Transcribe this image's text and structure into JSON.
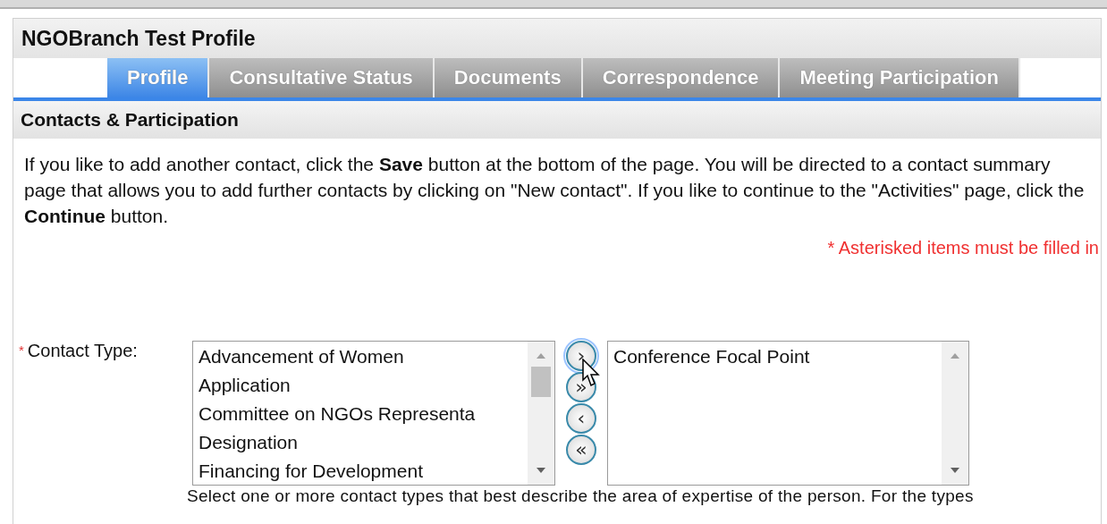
{
  "title": "NGOBranch Test Profile",
  "tabs": [
    {
      "label": "Profile",
      "selected": true
    },
    {
      "label": "Consultative Status",
      "selected": false
    },
    {
      "label": "Documents",
      "selected": false
    },
    {
      "label": "Correspondence",
      "selected": false
    },
    {
      "label": "Meeting Participation",
      "selected": false
    }
  ],
  "section": {
    "title": "Contacts & Participation"
  },
  "intro": "If you like to add another contact, click the **Save** button at the bottom of the page. You will be directed to a contact summary page that allows you to add further contacts by clicking on \"New contact\". If you like to continue to the \"Activities\" page, click the **Continue** button.",
  "required_note": "* Asterisked items must be filled in",
  "contact_type": {
    "required_mark": "*",
    "label": "Contact Type:",
    "available": [
      "Advancement of Women",
      "Application",
      "Committee on NGOs Representa",
      "Designation",
      "Financing for Development"
    ],
    "chosen": [
      "Conference Focal Point"
    ],
    "move_buttons": [
      {
        "label": "›",
        "focused": true
      },
      {
        "label": "»",
        "focused": false
      },
      {
        "label": "‹",
        "focused": false
      },
      {
        "label": "«",
        "focused": false
      }
    ],
    "help": "Select one or more contact types that best describe the area of expertise of the person. For the types"
  }
}
